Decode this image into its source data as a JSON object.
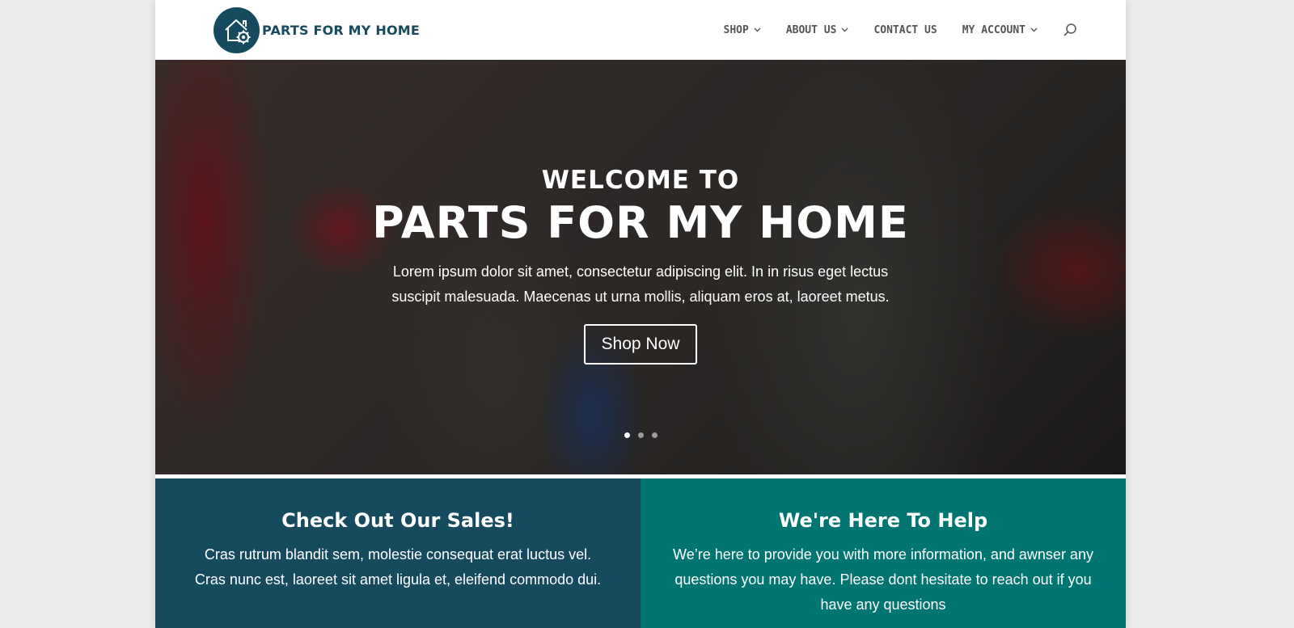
{
  "header": {
    "logo_text": "PARTS FOR MY HOME",
    "nav": [
      {
        "label": "SHOP",
        "has_dropdown": true
      },
      {
        "label": "ABOUT US",
        "has_dropdown": true
      },
      {
        "label": "CONTACT US",
        "has_dropdown": false
      },
      {
        "label": "MY ACCOUNT",
        "has_dropdown": true
      }
    ],
    "search_icon": "search-icon"
  },
  "hero": {
    "eyebrow": "WELCOME TO",
    "title": "PARTS FOR MY HOME",
    "text": "Lorem ipsum dolor sit amet, consectetur adipiscing elit. In in risus eget lectus suscipit malesuada. Maecenas ut urna mollis, aliquam eros at, laoreet metus.",
    "button_label": "Shop Now",
    "slides": 3,
    "active_slide": 1
  },
  "promos": [
    {
      "title": "Check Out Our Sales!",
      "text": "Cras rutrum blandit sem, molestie consequat erat luctus vel. Cras nunc est, laoreet sit amet ligula et, eleifend commodo dui."
    },
    {
      "title": "We're Here To Help",
      "text": "We’re here to provide you with more information, and awnser any questions you may have. Please dont hesitate to reach out if you have any questions"
    }
  ],
  "colors": {
    "brand": "#164a5e",
    "teal": "#007572",
    "nav_text": "#555555"
  }
}
